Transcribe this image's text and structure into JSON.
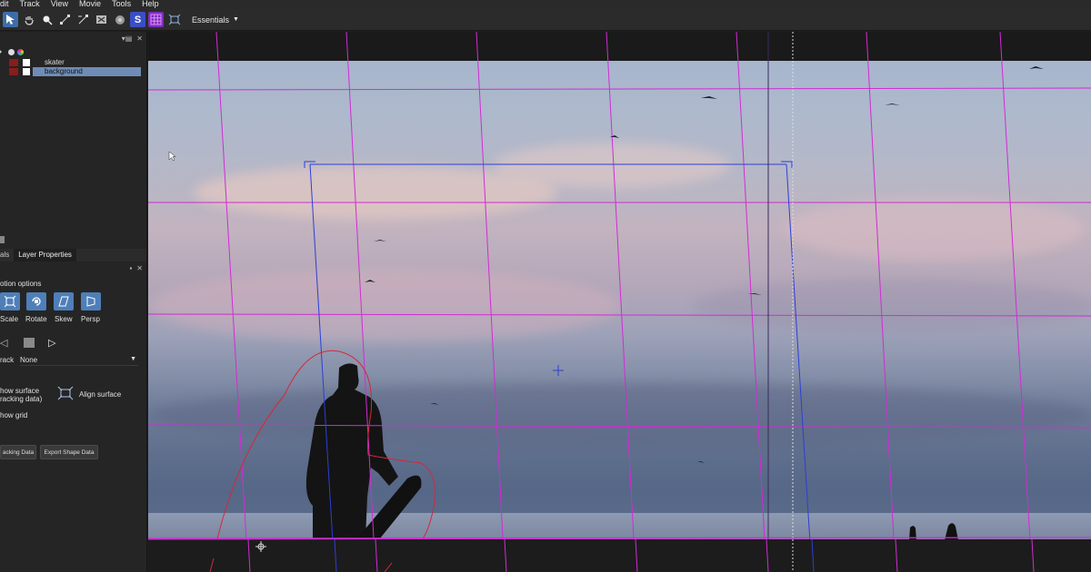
{
  "menu": [
    "dit",
    "Track",
    "View",
    "Movie",
    "Tools",
    "Help"
  ],
  "toolbar": {
    "tools": [
      {
        "icon": "pointer-icon",
        "active": true
      },
      {
        "icon": "hand-icon"
      },
      {
        "icon": "zoom-icon"
      },
      {
        "icon": "add-point-icon"
      },
      {
        "icon": "remove-point-icon"
      },
      {
        "icon": "close-spline-icon"
      },
      {
        "icon": "feather-icon"
      },
      {
        "icon": "surface-s-icon",
        "label": "S"
      },
      {
        "icon": "grid-icon"
      },
      {
        "icon": "corner-pin-icon"
      }
    ],
    "workspace": "Essentials"
  },
  "layers": {
    "items": [
      {
        "name": "skater",
        "selected": false
      },
      {
        "name": "background",
        "selected": true
      }
    ]
  },
  "tabs": [
    {
      "label": "als",
      "active": false
    },
    {
      "label": "Layer Properties",
      "active": true
    }
  ],
  "properties": {
    "motion_options_label": "otion options",
    "motion_buttons": [
      {
        "label": "Scale",
        "icon": "scale-icon"
      },
      {
        "label": "Rotate",
        "icon": "rotate-icon"
      },
      {
        "label": "Skew",
        "icon": "skew-icon"
      },
      {
        "label": "Persp",
        "icon": "perspective-icon"
      }
    ],
    "track_label": "rack",
    "track_value": "None",
    "show_surface_label_1": "how surface",
    "show_surface_label_2": "racking data)",
    "align_surface_label": "Align surface",
    "show_grid_label": "how grid",
    "export_tracking_label": "acking Data",
    "export_shape_label": "Export Shape Data"
  },
  "colors": {
    "grid_magenta": "#d22bd6",
    "surface_blue": "#2d3fd6",
    "spline_red": "#d6283a",
    "selection_blue": "#6f8cb6"
  }
}
